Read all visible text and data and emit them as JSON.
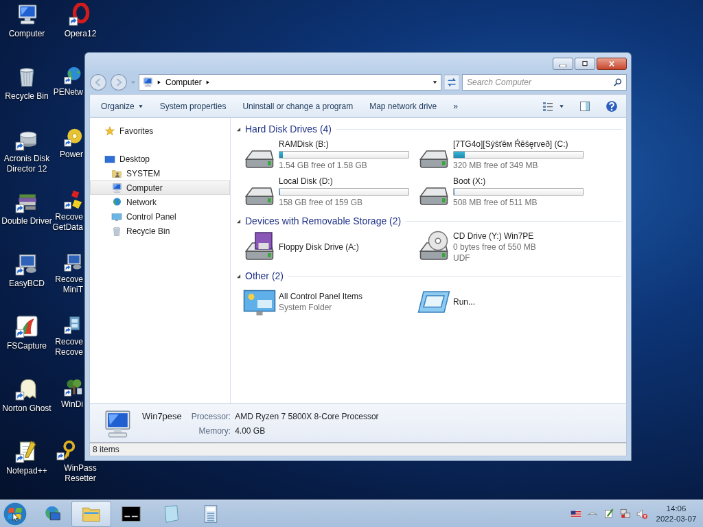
{
  "desktop": {
    "icons": [
      {
        "lines": [
          "Computer"
        ],
        "shortcut": false,
        "clipped": false
      },
      {
        "lines": [
          "Opera12"
        ],
        "shortcut": true,
        "clipped": false
      },
      {
        "lines": [
          "Recycle Bin"
        ],
        "shortcut": false,
        "clipped": false
      },
      {
        "lines": [
          "PENetw"
        ],
        "shortcut": true,
        "clipped": true
      },
      {
        "lines": [
          "Acronis Disk",
          "Director 12"
        ],
        "shortcut": true,
        "clipped": false
      },
      {
        "lines": [
          "Power"
        ],
        "shortcut": true,
        "clipped": true
      },
      {
        "lines": [
          "Double Driver"
        ],
        "shortcut": true,
        "clipped": false
      },
      {
        "lines": [
          "Recove",
          "GetData"
        ],
        "shortcut": true,
        "clipped": true
      },
      {
        "lines": [
          "EasyBCD"
        ],
        "shortcut": true,
        "clipped": false
      },
      {
        "lines": [
          "Recove",
          "MiniT"
        ],
        "shortcut": true,
        "clipped": true
      },
      {
        "lines": [
          "FSCapture"
        ],
        "shortcut": true,
        "clipped": false
      },
      {
        "lines": [
          "Recove",
          "Recove"
        ],
        "shortcut": true,
        "clipped": true
      },
      {
        "lines": [
          "Norton Ghost"
        ],
        "shortcut": true,
        "clipped": false
      },
      {
        "lines": [
          "WinDi"
        ],
        "shortcut": true,
        "clipped": true
      },
      {
        "lines": [
          "Notepad++"
        ],
        "shortcut": true,
        "clipped": false
      },
      {
        "lines": [
          "WinPass",
          "Resetter"
        ],
        "shortcut": true,
        "clipped": false
      }
    ]
  },
  "window": {
    "address": {
      "crumbs": [
        "Computer"
      ]
    },
    "search": {
      "placeholder": "Search Computer"
    },
    "toolbar": {
      "commands": [
        {
          "label": "Organize",
          "menu": true
        },
        {
          "label": "System properties",
          "menu": false
        },
        {
          "label": "Uninstall or change a program",
          "menu": false
        },
        {
          "label": "Map network drive",
          "menu": false
        },
        {
          "label": "»",
          "menu": false
        }
      ]
    },
    "navigation": [
      {
        "label": "Favorites",
        "selected": false
      },
      {
        "label": "Desktop",
        "selected": false,
        "children": [
          {
            "label": "SYSTEM",
            "selected": false
          },
          {
            "label": "Computer",
            "selected": true
          },
          {
            "label": "Network",
            "selected": false
          },
          {
            "label": "Control Panel",
            "selected": false
          },
          {
            "label": "Recycle Bin",
            "selected": false
          }
        ]
      }
    ],
    "groups": [
      {
        "title": "Hard Disk Drives (4)",
        "items": [
          {
            "kind": "hdd",
            "name": "RAMDisk (B:)",
            "level": 0.025,
            "details": [
              "1.54 GB free of 1.58 GB"
            ]
          },
          {
            "kind": "hdd",
            "name": "[7TG4o][Sýŝťĕм Ŕĕŝęrveð] (C:)",
            "level": 0.083,
            "details": [
              "320 MB free of 349 MB"
            ]
          },
          {
            "kind": "hdd",
            "name": "Local Disk (D:)",
            "level": 0.006,
            "details": [
              "158 GB free of 159 GB"
            ]
          },
          {
            "kind": "hdd",
            "name": "Boot (X:)",
            "level": 0.006,
            "details": [
              "508 MB free of 511 MB"
            ]
          }
        ]
      },
      {
        "title": "Devices with Removable Storage (2)",
        "items": [
          {
            "kind": "floppy",
            "name": "Floppy Disk Drive (A:)"
          },
          {
            "kind": "cd",
            "name": "CD Drive (Y:) Win7PE",
            "details": [
              "0 bytes free of 550 MB",
              "UDF"
            ]
          }
        ]
      },
      {
        "title": "Other (2)",
        "items": [
          {
            "kind": "panel",
            "name": "All Control Panel Items",
            "details": [
              "System Folder"
            ]
          },
          {
            "kind": "run",
            "name": "Run..."
          }
        ]
      }
    ],
    "details_pane": {
      "name": "Win7pese",
      "fields": [
        {
          "label": "Processor:",
          "value": "AMD Ryzen 7 5800X 8-Core Processor"
        },
        {
          "label": "Memory:",
          "value": "4.00 GB"
        }
      ]
    },
    "status_bar": "8 items"
  },
  "taskbar": {
    "apps": [
      {
        "selected": false
      },
      {
        "selected": true
      },
      {
        "selected": false
      },
      {
        "selected": false
      },
      {
        "selected": false
      }
    ],
    "clock": {
      "time": "14:06",
      "date": "2022-03-07"
    }
  }
}
